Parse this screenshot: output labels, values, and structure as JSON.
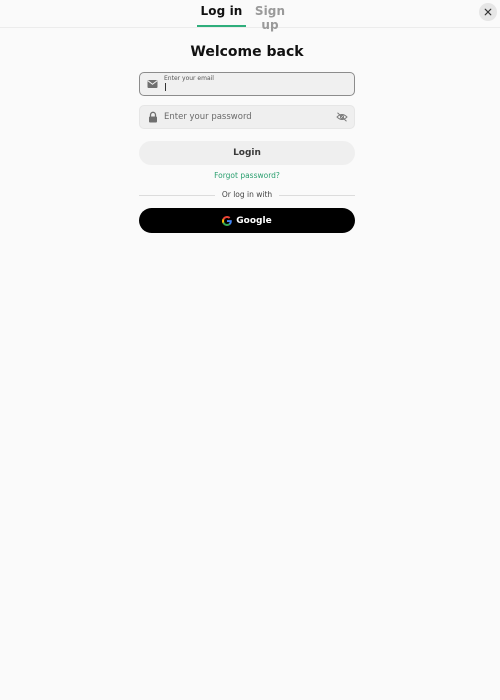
{
  "tabs": {
    "login_label": "Log in",
    "signup_label": "Sign up"
  },
  "form": {
    "title": "Welcome back",
    "email": {
      "label": "Enter your email",
      "value": ""
    },
    "password": {
      "placeholder": "Enter your password",
      "value": ""
    },
    "login_label": "Login",
    "forgot_label": "Forgot password?",
    "divider_label": "Or log in with",
    "google_label": "Google"
  },
  "colors": {
    "accent": "#2fae7c",
    "link": "#2a9f6f",
    "google_button_bg": "#000000"
  },
  "icons": {
    "close": "close-icon",
    "email": "envelope-icon",
    "password": "lock-icon",
    "toggle_visibility": "eye-off-icon",
    "google": "google-logo-icon"
  }
}
